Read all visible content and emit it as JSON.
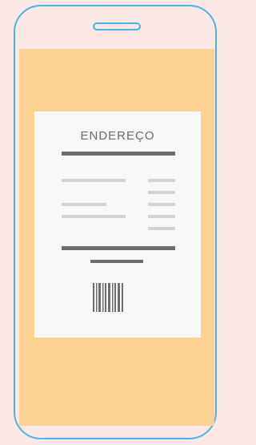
{
  "receipt": {
    "title": "ENDEREÇO"
  },
  "colors": {
    "background": "#fce9e5",
    "phone_outline": "#4ab3e6",
    "screen": "#fbd291",
    "paper": "#f8f8f6",
    "ink_dark": "#6d6d6d",
    "ink_light": "#d2d2d2"
  },
  "icons": {
    "barcode": "barcode-icon"
  }
}
